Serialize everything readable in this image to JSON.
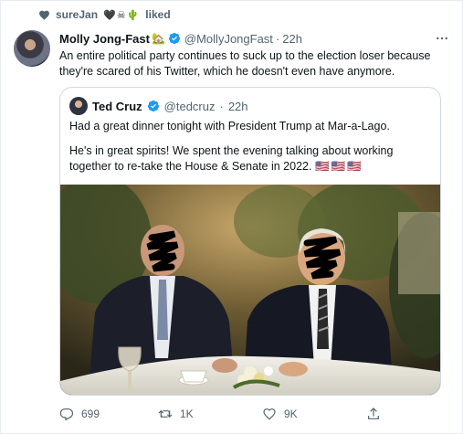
{
  "social_context": {
    "user": "sureJan",
    "emoji": "🖤☠🌵",
    "action": "liked"
  },
  "tweet": {
    "author_name": "Molly Jong-Fast",
    "author_badge": "🏡",
    "handle": "@MollyJongFast",
    "separator": "·",
    "time": "22h",
    "text": "An entire political party continues to suck up to the election loser because they're scared of his Twitter, which he doesn't even have anymore."
  },
  "quoted": {
    "author_name": "Ted Cruz",
    "handle": "@tedcruz",
    "separator": "·",
    "time": "22h",
    "paragraph1": "Had a great dinner tonight with President Trump at Mar-a-Lago.",
    "paragraph2": "He's in great spirits! We spent the evening talking about working together to re-take the House & Senate in 2022.",
    "flags": "🇺🇸🇺🇸🇺🇸"
  },
  "actions": {
    "replies": "699",
    "retweets": "1K",
    "likes": "9K"
  },
  "colors": {
    "text": "#0f1419",
    "muted": "#536471",
    "verified": "#1d9bf0",
    "border": "#cfd9de"
  },
  "icons": [
    "heart-icon",
    "verified-icon",
    "more-icon",
    "reply-icon",
    "retweet-icon",
    "like-icon",
    "share-icon"
  ]
}
